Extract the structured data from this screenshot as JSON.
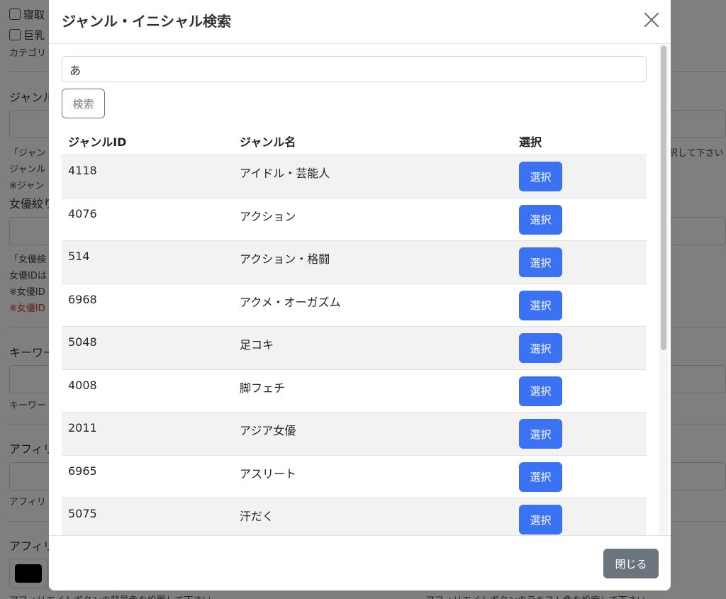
{
  "background": {
    "checkbox_1": "寝取",
    "checkbox_2": "巨乳",
    "category_note": "カテゴリ",
    "genre_label": "ジャンル",
    "genre_note_1": "「ジャン",
    "genre_note_2": "ジャンル",
    "genre_note_3": "※ジャン",
    "actress_label": "女優絞り",
    "actress_note_1": "「女優検",
    "actress_note_2": "女優IDは",
    "actress_note_3": "※女優ID",
    "actress_warning": "※女優ID",
    "keyword_label": "キーワー",
    "keyword_note": "キーワー",
    "affiliate_label_1": "アフィリ",
    "affiliate_note": "アフィリ",
    "affiliate_label_2": "アフィリ",
    "right_note": "択して下さい",
    "bg_color_note": "アフィリエイトボタンの背景色を設置して下さい",
    "text_color_note": "アフィリエイトボタンのテキスト色を設定して下さい",
    "swatch_color": "#000000"
  },
  "modal": {
    "title": "ジャンル・イニシャル検索",
    "close_icon": "close-x-icon",
    "search": {
      "value": "あ",
      "button_label": "検索"
    },
    "table": {
      "headers": {
        "id": "ジャンルID",
        "name": "ジャンル名",
        "select": "選択"
      },
      "rows": [
        {
          "id": "4118",
          "name": "アイドル・芸能人",
          "button": "選択"
        },
        {
          "id": "4076",
          "name": "アクション",
          "button": "選択"
        },
        {
          "id": "514",
          "name": "アクション・格闘",
          "button": "選択"
        },
        {
          "id": "6968",
          "name": "アクメ・オーガズム",
          "button": "選択"
        },
        {
          "id": "5048",
          "name": "足コキ",
          "button": "選択"
        },
        {
          "id": "4008",
          "name": "脚フェチ",
          "button": "選択"
        },
        {
          "id": "2011",
          "name": "アジア女優",
          "button": "選択"
        },
        {
          "id": "6965",
          "name": "アスリート",
          "button": "選択"
        },
        {
          "id": "5075",
          "name": "汗だく",
          "button": "選択"
        }
      ]
    },
    "footer": {
      "close_label": "閉じる"
    },
    "colors": {
      "primary": "#3b71f3",
      "secondary": "#6c757d"
    }
  }
}
